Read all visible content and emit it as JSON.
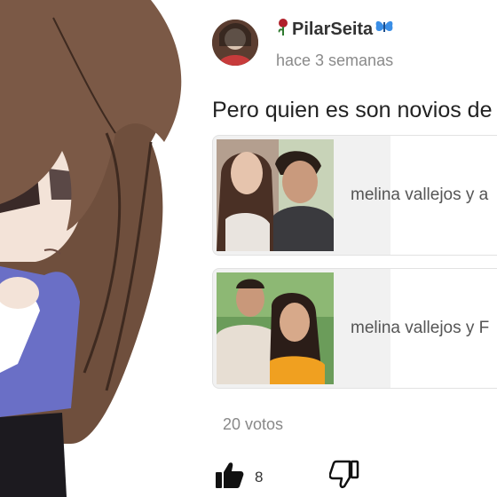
{
  "post": {
    "username": "PilarSeita",
    "time": "hace 3 semanas",
    "question": "Pero quien es son novios de"
  },
  "poll": {
    "options": [
      {
        "label": "melina vallejos y a"
      },
      {
        "label": "melina vallejos y F"
      }
    ],
    "votes": "20 votos"
  },
  "actions": {
    "likes": "8"
  },
  "icons": {
    "username_prefix": "rose-icon",
    "username_suffix": "butterfly-icon",
    "like": "thumbs-up-icon",
    "dislike": "thumbs-down-icon"
  },
  "colors": {
    "text": "#222222",
    "muted": "#888888",
    "option_bg": "#f1f1f1",
    "butterfly": "#3a8ee6",
    "rose": "#b0202a"
  }
}
